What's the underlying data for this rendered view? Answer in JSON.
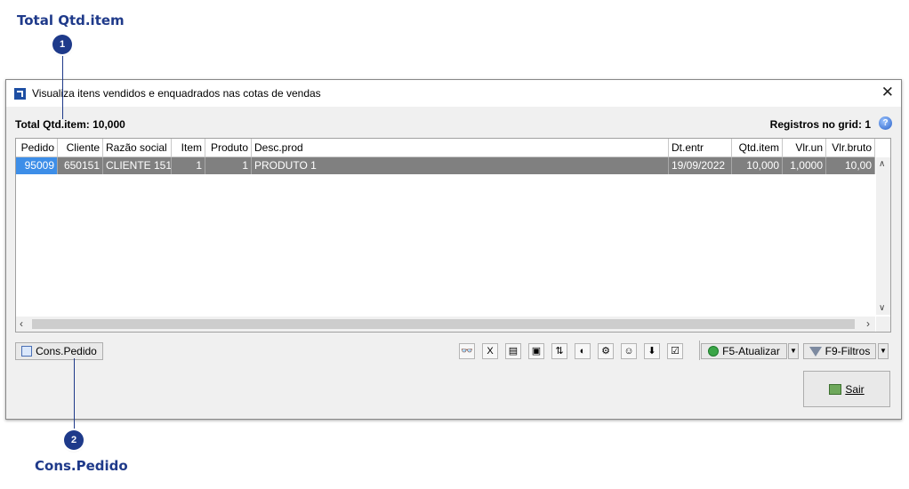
{
  "callouts": [
    {
      "number": "1",
      "label": "Total Qtd.item"
    },
    {
      "number": "2",
      "label": "Cons.Pedido"
    }
  ],
  "window": {
    "title": "Visualiza itens vendidos e enquadrados nas cotas de vendas",
    "close_icon": "close-icon",
    "summary": "Total Qtd.item: 10,000",
    "registros": "Registros no grid: 1",
    "help_glyph": "?"
  },
  "grid": {
    "columns": [
      "Pedido",
      "Cliente",
      "Razão social",
      "Item",
      "Produto",
      "Desc.prod",
      "Dt.entr",
      "Qtd.item",
      "Vlr.un",
      "Vlr.bruto"
    ],
    "rows": [
      [
        "95009",
        "650151",
        "CLIENTE 151",
        "1",
        "1",
        "PRODUTO 1",
        "19/09/2022",
        "10,000",
        "1,0000",
        "10,00"
      ]
    ],
    "selected_row_color": "#808080",
    "selected_cell_color": "#3d8ee8"
  },
  "buttons": {
    "cons_pedido": "Cons.Pedido",
    "atualizar": "F5-Atualizar",
    "filtros": "F9-Filtros",
    "sair": "Sair"
  },
  "toolbar_icons": [
    "glasses-icon",
    "excel-icon",
    "document-icon",
    "image-icon",
    "sort-icon",
    "palette-icon",
    "gear-icon",
    "users-icon",
    "export-icon",
    "checklist-icon"
  ],
  "colors": {
    "callout": "#1e3a8a",
    "accent": "#1e4fa3"
  }
}
